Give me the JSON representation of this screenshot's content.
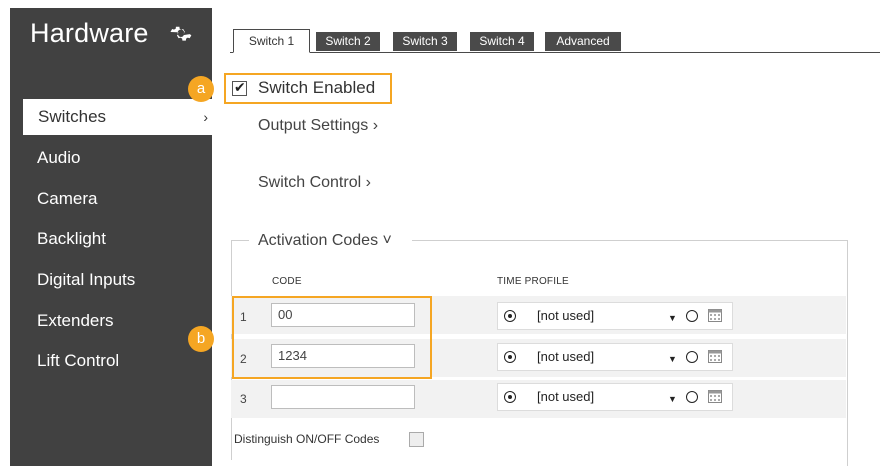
{
  "sidebar": {
    "title": "Hardware",
    "gear_icon": "gear-icon",
    "items": [
      {
        "label": "Switches",
        "active": true
      },
      {
        "label": "Audio"
      },
      {
        "label": "Camera"
      },
      {
        "label": "Backlight"
      },
      {
        "label": "Digital Inputs"
      },
      {
        "label": "Extenders"
      },
      {
        "label": "Lift Control"
      }
    ],
    "chevron": "›"
  },
  "tabs": [
    {
      "label": "Switch 1",
      "active": true
    },
    {
      "label": "Switch 2"
    },
    {
      "label": "Switch 3"
    },
    {
      "label": "Switch 4"
    },
    {
      "label": "Advanced"
    }
  ],
  "badges": {
    "a": "a",
    "b": "b"
  },
  "switch_enabled": {
    "label": "Switch Enabled",
    "checked": true
  },
  "sections": {
    "output_settings": "Output Settings ›",
    "switch_control": "Switch Control ›",
    "activation_codes": "Activation Codes ˅"
  },
  "table": {
    "headers": {
      "code": "CODE",
      "time_profile": "TIME PROFILE"
    },
    "rows": [
      {
        "num": "1",
        "code": "00",
        "profile": "[not used]"
      },
      {
        "num": "2",
        "code": "1234",
        "profile": "[not used]"
      },
      {
        "num": "3",
        "code": "",
        "profile": "[not used]"
      }
    ]
  },
  "distinguish": {
    "label": "Distinguish ON/OFF Codes",
    "checked": false
  },
  "colors": {
    "sidebar_bg": "#414141",
    "accent": "#f5a623",
    "tab_bg": "#4a4a4a"
  }
}
